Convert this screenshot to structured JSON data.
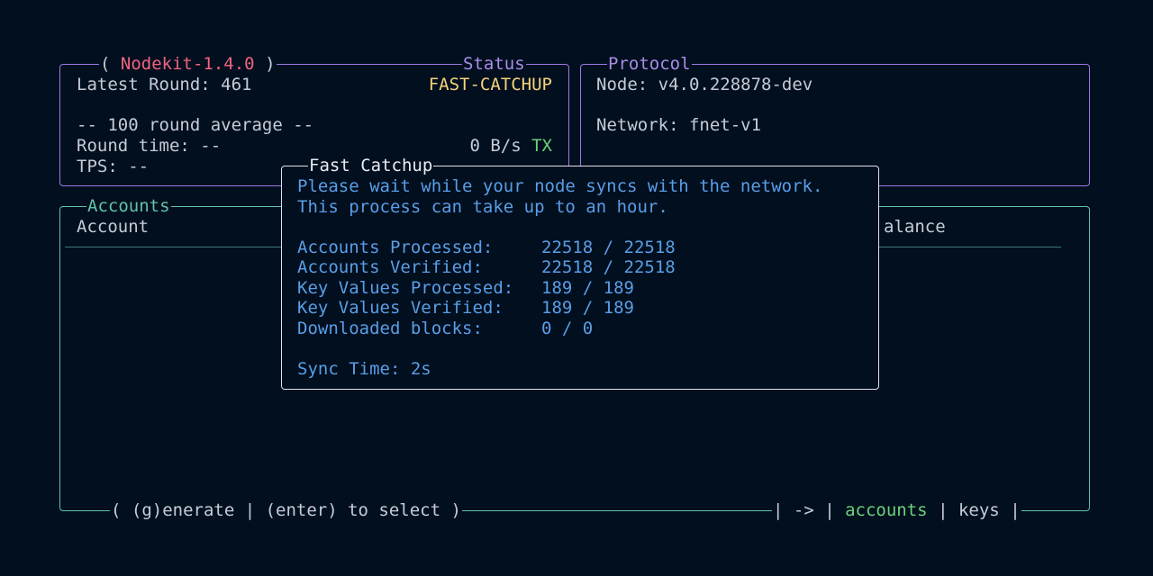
{
  "status_panel": {
    "title_open": "(",
    "app_name": "Nodekit-1.4.0",
    "title_close": ")",
    "label": "Status",
    "latest_round": "Latest Round: 461",
    "state": "FAST-CATCHUP",
    "average_header": "-- 100 round average --",
    "round_time": "Round time: --",
    "bandwidth": "0 B/s",
    "tx_label": "TX",
    "tps": "TPS: --"
  },
  "protocol_panel": {
    "label": "Protocol",
    "node": "Node: v4.0.228878-dev",
    "network": "Network: fnet-v1"
  },
  "accounts_panel": {
    "label": "Accounts",
    "columns": [
      "Account",
      "alance"
    ],
    "footer_left": "( (g)enerate | (enter) to select )",
    "footer_nav_prefix": "| -> |",
    "footer_tab_accounts": "accounts",
    "footer_sep": "|",
    "footer_tab_keys": "keys",
    "footer_end": "|"
  },
  "modal": {
    "title": "Fast Catchup",
    "message_line1": "Please wait while your node syncs with the network.",
    "message_line2": "This process can take up to an hour.",
    "rows": [
      {
        "label": "Accounts Processed:",
        "value": "22518 / 22518"
      },
      {
        "label": "Accounts Verified:",
        "value": "22518 / 22518"
      },
      {
        "label": "Key Values Processed:",
        "value": "189 / 189"
      },
      {
        "label": "Key Values Verified:",
        "value": "189 / 189"
      },
      {
        "label": "Downloaded blocks:",
        "value": "0 / 0"
      }
    ],
    "sync_time": "Sync Time: 2s"
  },
  "colors": {
    "background": "#010f1f",
    "app_name": "#f0647f",
    "status_border": "#9a7be6",
    "accounts_border": "#61c2a8",
    "state": "#f5d37a",
    "tx": "#6bd27a",
    "modal_text": "#5a9ee6"
  }
}
